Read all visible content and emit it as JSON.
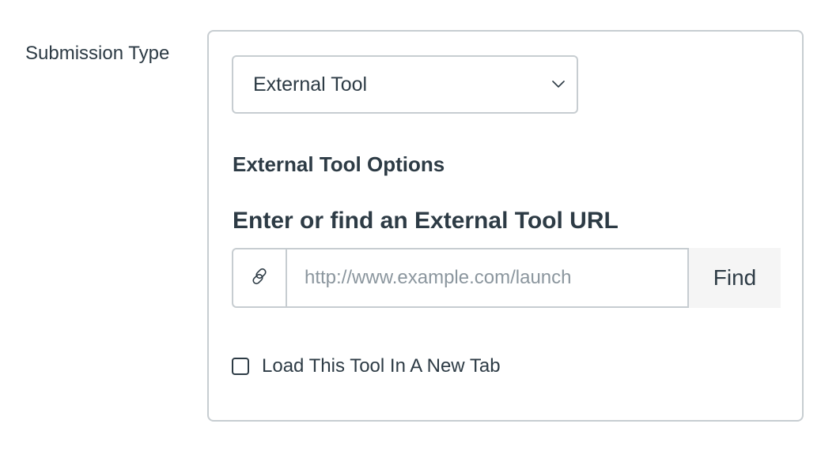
{
  "submission_type": {
    "label": "Submission Type",
    "selected_value": "External Tool"
  },
  "external_tool": {
    "section_heading": "External Tool Options",
    "url_heading": "Enter or find an External Tool URL",
    "url_value": "",
    "url_placeholder": "http://www.example.com/launch",
    "find_label": "Find",
    "new_tab_label": "Load This Tool In A New Tab",
    "new_tab_checked": false
  },
  "icons": {
    "select_chevron": "chevron-down-icon",
    "url_prefix": "link-icon"
  },
  "colors": {
    "text": "#2d3b45",
    "border": "#c7cdd1",
    "placeholder": "#8b969e",
    "button_background": "#f5f5f5"
  }
}
